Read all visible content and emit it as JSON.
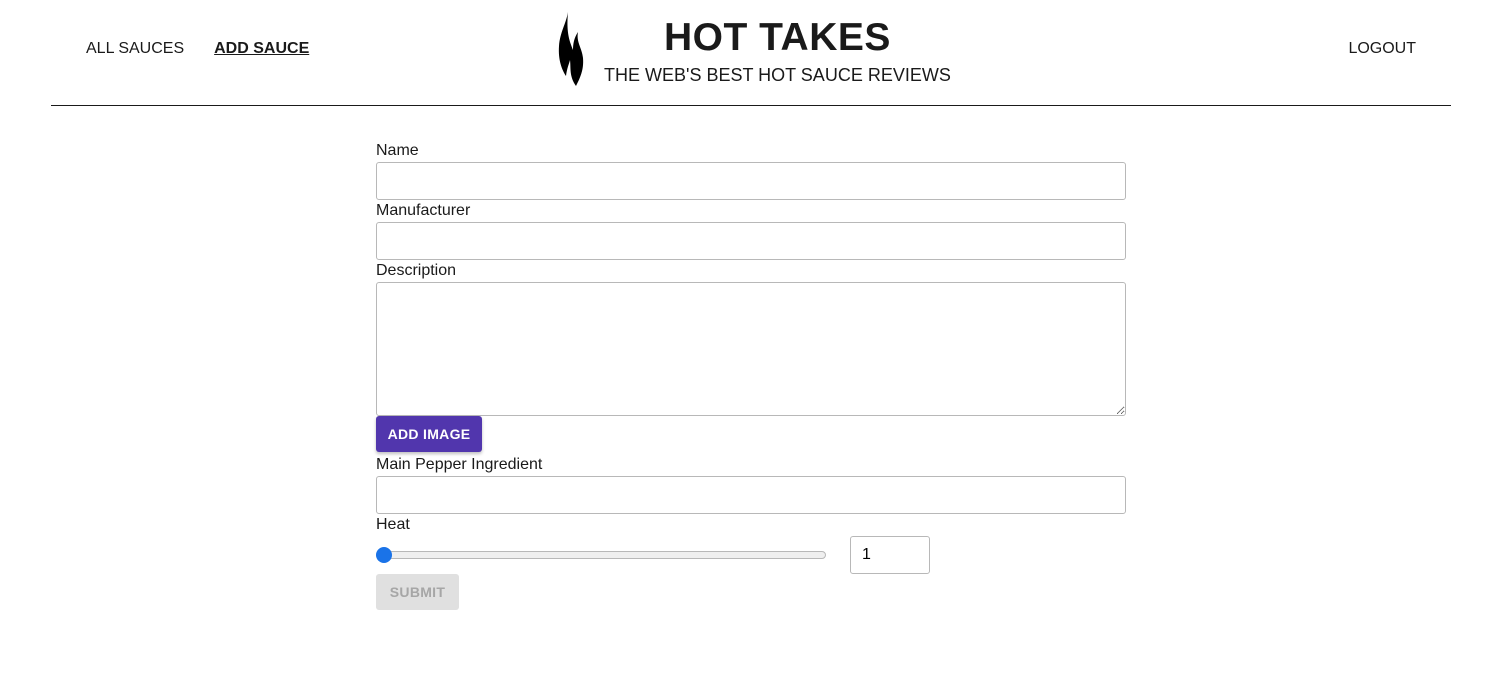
{
  "nav": {
    "all_sauces": "ALL SAUCES",
    "add_sauce": "ADD SAUCE",
    "logout": "LOGOUT"
  },
  "brand": {
    "title": "HOT TAKES",
    "subtitle": "THE WEB'S BEST HOT SAUCE REVIEWS",
    "logo_icon": "flame-icon"
  },
  "form": {
    "name": {
      "label": "Name",
      "value": ""
    },
    "manufacturer": {
      "label": "Manufacturer",
      "value": ""
    },
    "description": {
      "label": "Description",
      "value": ""
    },
    "add_image_label": "ADD IMAGE",
    "main_pepper": {
      "label": "Main Pepper Ingredient",
      "value": ""
    },
    "heat": {
      "label": "Heat",
      "value": "1",
      "min": 1,
      "max": 10
    },
    "submit_label": "SUBMIT"
  },
  "colors": {
    "accent": "#5136ad",
    "slider_thumb": "#1a73e8",
    "submit_disabled_bg": "#e0e0e0",
    "submit_disabled_text": "#a6a6a6"
  }
}
